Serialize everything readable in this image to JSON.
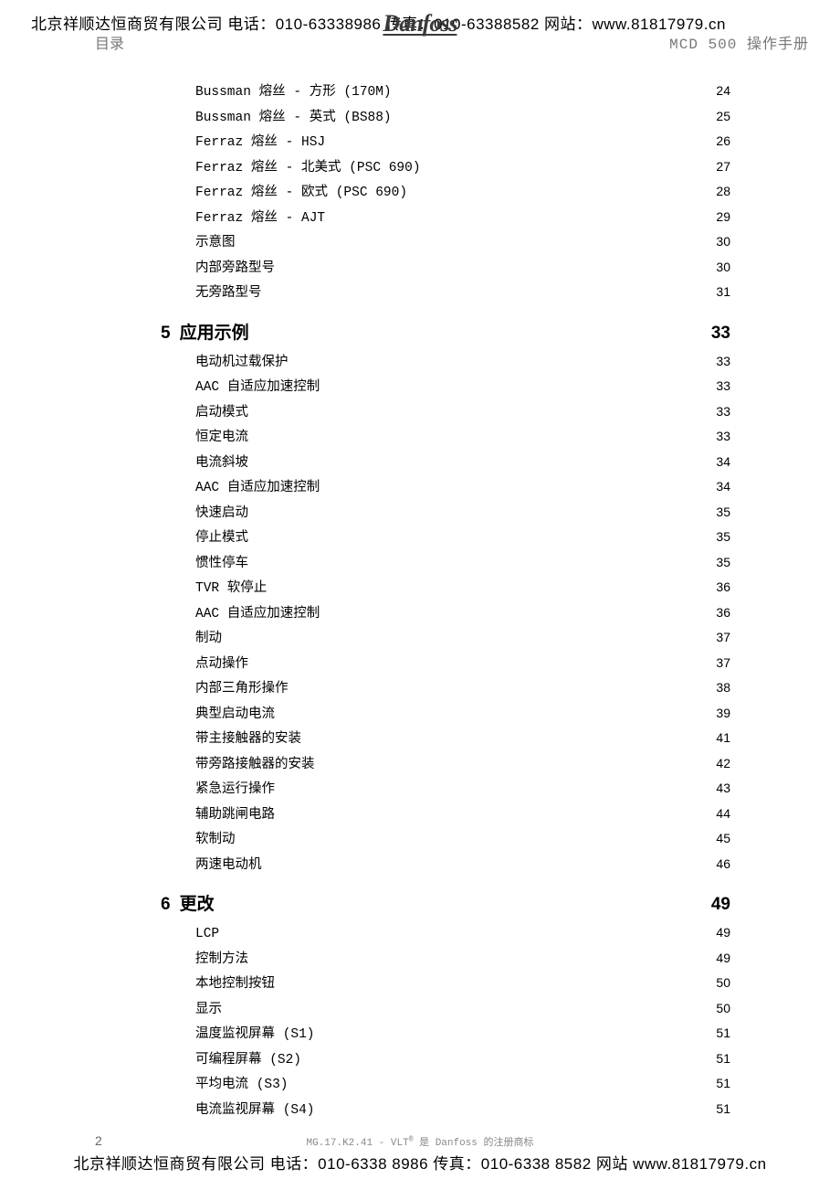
{
  "header": {
    "company_line": "北京祥顺达恒商贸有限公司 电话：010-63338986 传真：010-63388582 网站：www.81817979.cn",
    "toc_label": "目录",
    "logo_text": "Danfoss",
    "right_label": "MCD 500 操作手册"
  },
  "toc": {
    "pre_entries": [
      {
        "title": "Bussman 熔丝 - 方形 (170M)",
        "page": "24"
      },
      {
        "title": "Bussman 熔丝 - 英式 (BS88)",
        "page": "25"
      },
      {
        "title": "Ferraz 熔丝 - HSJ",
        "page": "26"
      },
      {
        "title": "Ferraz 熔丝 - 北美式 (PSC 690)",
        "page": "27"
      },
      {
        "title": "Ferraz 熔丝 - 欧式 (PSC 690)",
        "page": "28"
      },
      {
        "title": "Ferraz 熔丝 - AJT",
        "page": "29"
      },
      {
        "title": "示意图",
        "page": "30"
      },
      {
        "title": "内部旁路型号",
        "page": "30"
      },
      {
        "title": "无旁路型号",
        "page": "31"
      }
    ],
    "sections": [
      {
        "num": "5",
        "title": "应用示例",
        "page": "33",
        "entries": [
          {
            "title": "电动机过载保护",
            "page": "33"
          },
          {
            "title": "AAC 自适应加速控制",
            "page": "33"
          },
          {
            "title": "启动模式",
            "page": "33"
          },
          {
            "title": "恒定电流",
            "page": "33"
          },
          {
            "title": "电流斜坡",
            "page": "34"
          },
          {
            "title": "AAC 自适应加速控制",
            "page": "34"
          },
          {
            "title": "快速启动",
            "page": "35"
          },
          {
            "title": "停止模式",
            "page": "35"
          },
          {
            "title": "惯性停车",
            "page": "35"
          },
          {
            "title": "TVR 软停止",
            "page": "36"
          },
          {
            "title": "AAC 自适应加速控制",
            "page": "36"
          },
          {
            "title": "制动",
            "page": "37"
          },
          {
            "title": "点动操作",
            "page": "37"
          },
          {
            "title": "内部三角形操作",
            "page": "38"
          },
          {
            "title": "典型启动电流",
            "page": "39"
          },
          {
            "title": "带主接触器的安装",
            "page": "41"
          },
          {
            "title": "带旁路接触器的安装",
            "page": "42"
          },
          {
            "title": "紧急运行操作",
            "page": "43"
          },
          {
            "title": "辅助跳闸电路",
            "page": "44"
          },
          {
            "title": "软制动",
            "page": "45"
          },
          {
            "title": "两速电动机",
            "page": "46"
          }
        ]
      },
      {
        "num": "6",
        "title": "更改",
        "page": "49",
        "entries": [
          {
            "title": "LCP",
            "page": "49"
          },
          {
            "title": "控制方法",
            "page": "49"
          },
          {
            "title": "本地控制按钮",
            "page": "50"
          },
          {
            "title": "显示",
            "page": "50"
          },
          {
            "title": "温度监视屏幕 (S1)",
            "page": "51"
          },
          {
            "title": "可编程屏幕 (S2)",
            "page": "51"
          },
          {
            "title": "平均电流 (S3)",
            "page": "51"
          },
          {
            "title": "电流监视屏幕 (S4)",
            "page": "51"
          }
        ]
      }
    ]
  },
  "footer": {
    "page_num": "2",
    "meta_pre": "MG.17.K2.41 - VLT",
    "meta_post": " 是 Danfoss 的注册商标",
    "company_line": "北京祥顺达恒商贸有限公司 电话：010-6338 8986 传真：010-6338 8582 网站 www.81817979.cn"
  }
}
